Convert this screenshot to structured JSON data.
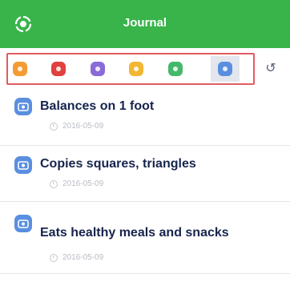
{
  "header": {
    "title": "Journal",
    "colors": {
      "background": "#38b44a",
      "text": "#ffffff"
    }
  },
  "filters": [
    {
      "name": "orange-filter",
      "color": "#f39c34"
    },
    {
      "name": "red-filter",
      "color": "#e0403e"
    },
    {
      "name": "purple-filter",
      "color": "#8a6bd6"
    },
    {
      "name": "yellow-filter",
      "color": "#f2b632"
    },
    {
      "name": "green-filter",
      "color": "#45b86b"
    },
    {
      "name": "blue-filter",
      "color": "#5a8fe0",
      "selected": true
    }
  ],
  "refresh_icon": "undo-arrow-icon",
  "entries": [
    {
      "title": "Balances on 1 foot",
      "date": "2016-05-09"
    },
    {
      "title": "Copies squares, triangles",
      "date": "2016-05-09"
    },
    {
      "title": "Eats healthy meals and snacks",
      "date": "2016-05-09"
    }
  ]
}
